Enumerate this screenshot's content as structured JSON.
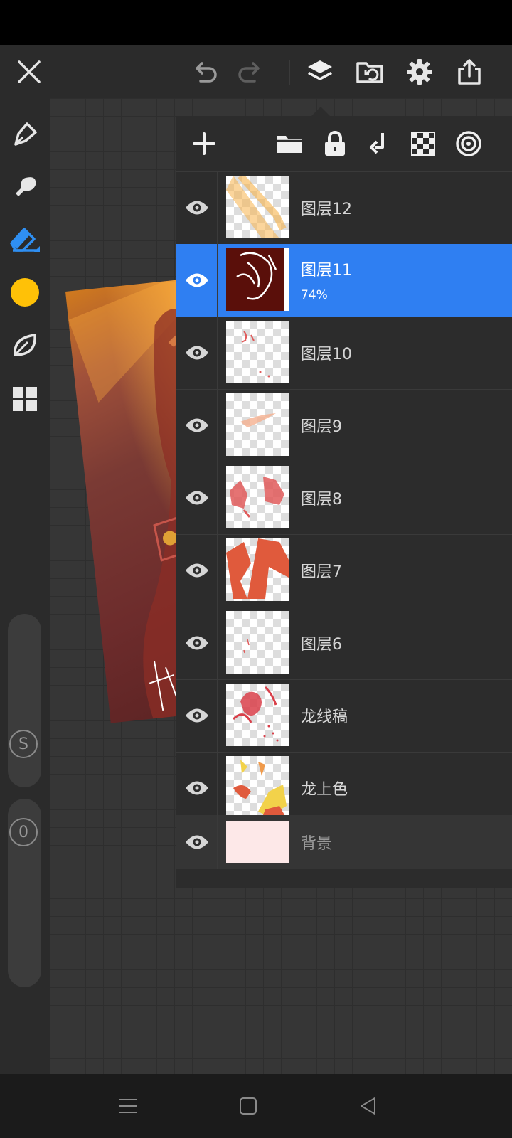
{
  "toolbar": {
    "close_icon": "close-icon",
    "undo_icon": "undo-icon",
    "redo_icon": "redo-icon",
    "layers_icon": "layers-icon",
    "import_icon": "folder-import-icon",
    "settings_icon": "gear-icon",
    "share_icon": "share-icon"
  },
  "left_tools": [
    "pen-icon",
    "brush-icon",
    "eraser-icon",
    "color-swatch",
    "leaf-icon",
    "grid-icon"
  ],
  "current_color": "#ffc107",
  "size_label": "S",
  "opacity_label": "0",
  "layer_panel_tools": [
    "add-icon",
    "folder-icon",
    "lock-icon",
    "merge-down-icon",
    "checker-icon",
    "target-icon"
  ],
  "layers": [
    {
      "name": "图层12",
      "opacity": "",
      "selected": false
    },
    {
      "name": "图层11",
      "opacity": "74%",
      "selected": true
    },
    {
      "name": "图层10",
      "opacity": "",
      "selected": false
    },
    {
      "name": "图层9",
      "opacity": "",
      "selected": false
    },
    {
      "name": "图层8",
      "opacity": "",
      "selected": false
    },
    {
      "name": "图层7",
      "opacity": "",
      "selected": false
    },
    {
      "name": "图层6",
      "opacity": "",
      "selected": false
    },
    {
      "name": "龙线稿",
      "opacity": "",
      "selected": false
    },
    {
      "name": "龙上色",
      "opacity": "",
      "selected": false
    }
  ],
  "background_layer": {
    "name": "背景"
  },
  "accent_color": "#2f7ff2"
}
